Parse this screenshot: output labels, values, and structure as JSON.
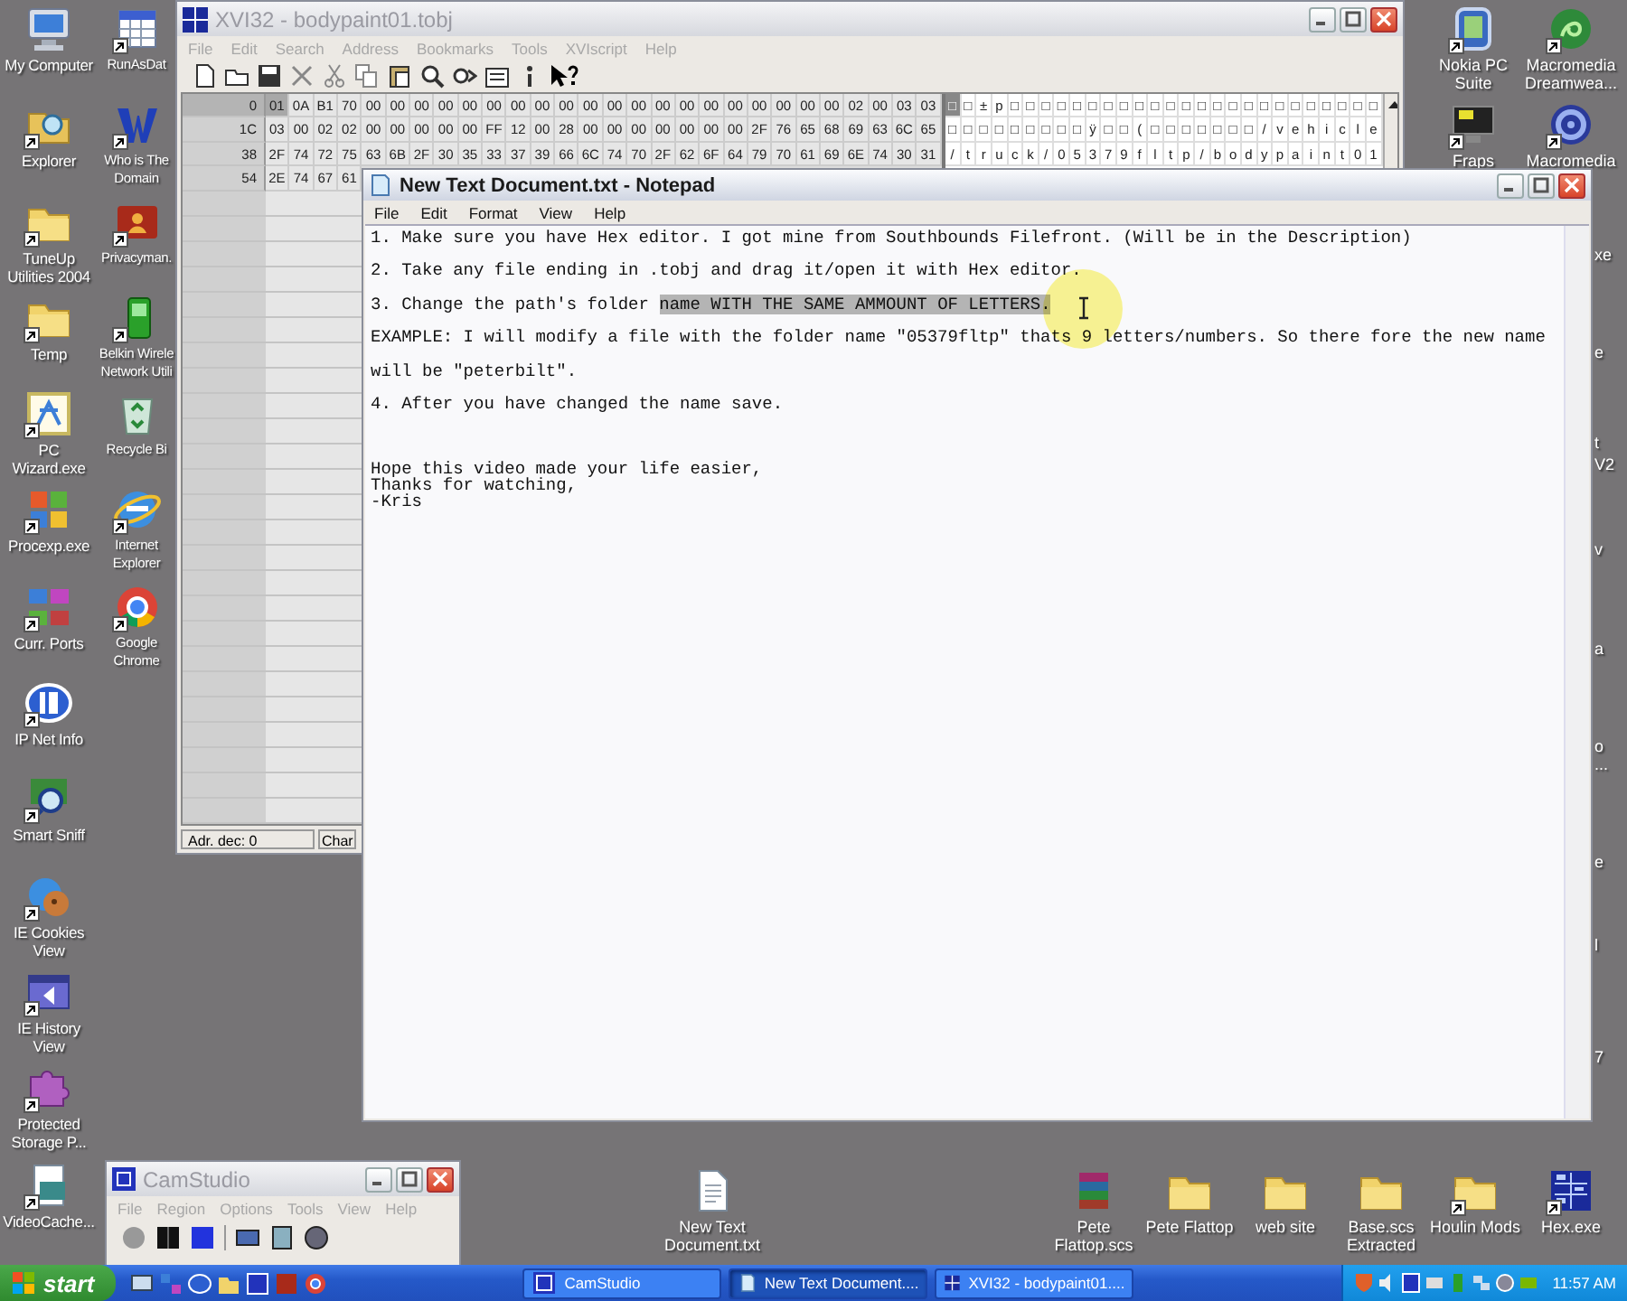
{
  "desktop": {
    "left_columns": [
      [
        {
          "label": "My Computer",
          "kind": "computer",
          "shortcut": false
        },
        {
          "label": "Explorer",
          "kind": "folder-search",
          "shortcut": true
        },
        {
          "label": "TuneUp Utilities 2004",
          "kind": "folder",
          "shortcut": true
        },
        {
          "label": "Temp",
          "kind": "folder",
          "shortcut": true
        },
        {
          "label": "PC Wizard.exe",
          "kind": "star",
          "shortcut": true
        },
        {
          "label": "Procexp.exe",
          "kind": "squares",
          "shortcut": true
        },
        {
          "label": "Curr. Ports",
          "kind": "network",
          "shortcut": true
        },
        {
          "label": "IP Net Info",
          "kind": "oval",
          "shortcut": true
        },
        {
          "label": "Smart Sniff",
          "kind": "magnifier",
          "shortcut": true
        },
        {
          "label": "IE Cookies View",
          "kind": "cookie",
          "shortcut": true
        },
        {
          "label": "IE History View",
          "kind": "window",
          "shortcut": true
        },
        {
          "label": "Protected Storage P...",
          "kind": "puzzle",
          "shortcut": true
        },
        {
          "label": "VideoCache...",
          "kind": "film",
          "shortcut": true
        }
      ],
      [
        {
          "label": "RunAsDat",
          "kind": "calendar",
          "shortcut": true
        },
        {
          "label": "Who is The Domain",
          "kind": "tile",
          "shortcut": true
        },
        {
          "label": "Privacyman.",
          "kind": "red-tile",
          "shortcut": true
        },
        {
          "label": "Belkin Wirele Network Utili",
          "kind": "phone",
          "shortcut": true
        },
        {
          "label": "Recycle Bi",
          "kind": "bin",
          "shortcut": false
        },
        {
          "label": "Internet Explorer",
          "kind": "globe",
          "shortcut": true
        },
        {
          "label": "Google Chrome",
          "kind": "ring",
          "shortcut": true
        }
      ]
    ],
    "right_columns": [
      [
        {
          "label": "Nokia PC Suite",
          "kind": "device",
          "shortcut": true
        },
        {
          "label": "Fraps",
          "kind": "monitor",
          "shortcut": true
        }
      ],
      [
        {
          "label": "Macromedia Dreamwea...",
          "kind": "swirl",
          "shortcut": true
        },
        {
          "label": "Macromedia",
          "kind": "gear",
          "shortcut": true
        }
      ]
    ],
    "bottom_icons": [
      {
        "label": "New Text Document.txt",
        "kind": "document",
        "shortcut": false
      },
      {
        "label": "Pete Flattop.scs",
        "kind": "archive",
        "shortcut": false
      },
      {
        "label": "Pete Flattop",
        "kind": "folder",
        "shortcut": false
      },
      {
        "label": "web site",
        "kind": "folder",
        "shortcut": false
      },
      {
        "label": "Base.scs Extracted",
        "kind": "folder",
        "shortcut": false
      },
      {
        "label": "Houlin Mods",
        "kind": "folder",
        "shortcut": true
      },
      {
        "label": "Hex.exe",
        "kind": "hexgrid",
        "shortcut": true
      }
    ],
    "edge_fragments": [
      "xe",
      "e",
      "t",
      "V2",
      "v",
      "a",
      "o",
      "...",
      "e",
      "l",
      "7"
    ]
  },
  "hex_editor": {
    "title": "XVI32 - bodypaint01.tobj",
    "menu": [
      "File",
      "Edit",
      "Search",
      "Address",
      "Bookmarks",
      "Tools",
      "XVIscript",
      "Help"
    ],
    "rows": [
      {
        "address": "0",
        "selected": true,
        "bytes": [
          "01",
          "0A",
          "B1",
          "70",
          "00",
          "00",
          "00",
          "00",
          "00",
          "00",
          "00",
          "00",
          "00",
          "00",
          "00",
          "00",
          "00",
          "00",
          "00",
          "00",
          "00",
          "00",
          "00",
          "00",
          "02",
          "00",
          "03",
          "03"
        ],
        "chars": [
          "□",
          "□",
          "±",
          "p",
          "□",
          "□",
          "□",
          "□",
          "□",
          "□",
          "□",
          "□",
          "□",
          "□",
          "□",
          "□",
          "□",
          "□",
          "□",
          "□",
          "□",
          "□",
          "□",
          "□",
          "□",
          "□",
          "□",
          "□"
        ]
      },
      {
        "address": "1C",
        "selected": false,
        "bytes": [
          "03",
          "00",
          "02",
          "02",
          "00",
          "00",
          "00",
          "00",
          "00",
          "FF",
          "12",
          "00",
          "28",
          "00",
          "00",
          "00",
          "00",
          "00",
          "00",
          "00",
          "2F",
          "76",
          "65",
          "68",
          "69",
          "63",
          "6C",
          "65"
        ],
        "chars": [
          "□",
          "□",
          "□",
          "□",
          "□",
          "□",
          "□",
          "□",
          "□",
          "ÿ",
          "□",
          "□",
          "(",
          "□",
          "□",
          "□",
          "□",
          "□",
          "□",
          "□",
          "/",
          "v",
          "e",
          "h",
          "i",
          "c",
          "l",
          "e"
        ]
      },
      {
        "address": "38",
        "selected": false,
        "bytes": [
          "2F",
          "74",
          "72",
          "75",
          "63",
          "6B",
          "2F",
          "30",
          "35",
          "33",
          "37",
          "39",
          "66",
          "6C",
          "74",
          "70",
          "2F",
          "62",
          "6F",
          "64",
          "79",
          "70",
          "61",
          "69",
          "6E",
          "74",
          "30",
          "31"
        ],
        "chars": [
          "/",
          "t",
          "r",
          "u",
          "c",
          "k",
          "/",
          "0",
          "5",
          "3",
          "7",
          "9",
          "f",
          "l",
          "t",
          "p",
          "/",
          "b",
          "o",
          "d",
          "y",
          "p",
          "a",
          "i",
          "n",
          "t",
          "0",
          "1"
        ]
      },
      {
        "address": "54",
        "selected": false,
        "bytes": [
          "2E",
          "74",
          "67",
          "61"
        ]
      }
    ],
    "status": [
      "Adr. dec: 0",
      "Char"
    ]
  },
  "notepad": {
    "title": "New Text Document.txt - Notepad",
    "menu": [
      "File",
      "Edit",
      "Format",
      "View",
      "Help"
    ],
    "lines": [
      {
        "parts": [
          {
            "text": "1. Make sure you have Hex editor. I got mine from Southbounds Filefront. (Will be in the Description)",
            "selected": false
          }
        ]
      },
      {
        "parts": [
          {
            "text": "2. Take any file ending in .tobj and drag it/open it with Hex editor.",
            "selected": false
          }
        ]
      },
      {
        "parts": [
          {
            "text": "3. Change the path's folder ",
            "selected": false
          },
          {
            "text": "name WITH THE SAME AMMOUNT OF LETTERS.",
            "selected": true
          }
        ]
      },
      {
        "parts": [
          {
            "text": "EXAMPLE: I will modify a file with the folder name \"05379fltp\" thats 9 letters/numbers. So there fore the new name",
            "selected": false
          }
        ]
      },
      {
        "parts": [
          {
            "text": "will be \"peterbilt\".",
            "selected": false
          }
        ]
      },
      {
        "parts": [
          {
            "text": "4. After you have changed the name save.",
            "selected": false
          }
        ]
      }
    ],
    "closing": [
      "Hope this video made your life easier,",
      "Thanks for watching,",
      "-Kris"
    ]
  },
  "camstudio": {
    "title": "CamStudio",
    "menu": [
      "File",
      "Region",
      "Options",
      "Tools",
      "View",
      "Help"
    ]
  },
  "taskbar": {
    "start": "start",
    "tasks": [
      {
        "label": "CamStudio",
        "kind": "camstudio",
        "selected": false
      },
      {
        "label": "New Text Document....",
        "kind": "notepad",
        "selected": true
      },
      {
        "label": "XVI32 - bodypaint01....",
        "kind": "hex",
        "selected": false
      }
    ],
    "clock": "11:57 AM"
  }
}
